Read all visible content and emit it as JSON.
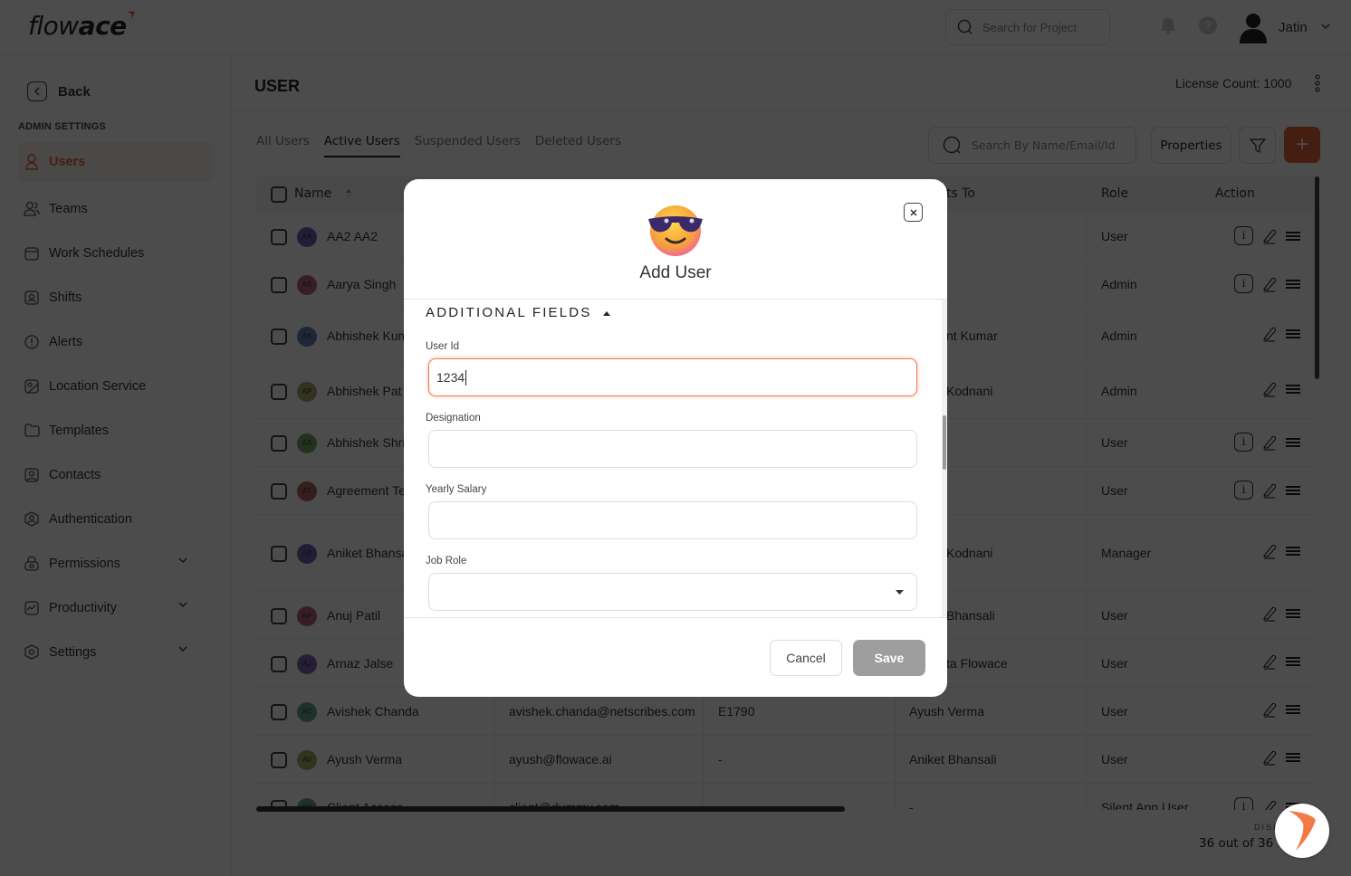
{
  "app": {
    "logo_text_light": "flow",
    "logo_text_bold": "ace",
    "brand_color": "#e8643c"
  },
  "topbar": {
    "project_search_placeholder": "Search for Project",
    "user_name": "Jatin",
    "help_glyph": "?"
  },
  "sidebar": {
    "back_label": "Back",
    "section_label": "ADMIN SETTINGS",
    "items": [
      {
        "label": "Users",
        "icon": "user-icon",
        "active": true
      },
      {
        "label": "Teams",
        "icon": "users-icon"
      },
      {
        "label": "Work Schedules",
        "icon": "calendar-icon"
      },
      {
        "label": "Shifts",
        "icon": "badge-icon"
      },
      {
        "label": "Alerts",
        "icon": "alert-icon"
      },
      {
        "label": "Location Service",
        "icon": "location-icon"
      },
      {
        "label": "Templates",
        "icon": "folder-icon"
      },
      {
        "label": "Contacts",
        "icon": "contact-icon"
      },
      {
        "label": "Authentication",
        "icon": "shield-user-icon"
      },
      {
        "label": "Permissions",
        "icon": "lock-icon",
        "expandable": true
      },
      {
        "label": "Productivity",
        "icon": "chart-icon",
        "expandable": true
      },
      {
        "label": "Settings",
        "icon": "gear-icon",
        "expandable": true
      }
    ]
  },
  "main": {
    "title": "USER",
    "license_count": "License Count: 1000",
    "tabs": [
      {
        "label": "All Users"
      },
      {
        "label": "Active Users",
        "active": true
      },
      {
        "label": "Suspended Users"
      },
      {
        "label": "Deleted Users"
      }
    ],
    "search_placeholder": "Search By Name/Email/Id",
    "properties_label": "Properties",
    "add_label": "+",
    "table": {
      "headers": {
        "name": "Name",
        "reports_to": "ts To",
        "role": "Role",
        "action": "Action"
      },
      "rows": [
        {
          "initials": "AA",
          "name": "AA2 AA2",
          "email": "",
          "emp_id": "",
          "reports_to": "",
          "role": "User",
          "info": true,
          "avatar_color": "#6b64b8"
        },
        {
          "initials": "AS",
          "name": "Aarya Singh",
          "email": "",
          "emp_id": "",
          "reports_to": "",
          "role": "Admin",
          "info": true,
          "avatar_color": "#b8647a"
        },
        {
          "initials": "AK",
          "name": "Abhishek Kum",
          "email": "",
          "emp_id": "",
          "reports_to": "nt Kumar",
          "role": "Admin",
          "info": false,
          "avatar_color": "#6480b8"
        },
        {
          "initials": "AP",
          "name": "Abhishek Pat",
          "email": "",
          "emp_id": "",
          "reports_to": "Kodnani",
          "role": "Admin",
          "info": false,
          "avatar_color": "#a8a864"
        },
        {
          "initials": "AS",
          "name": "Abhishek Shri",
          "email": "",
          "emp_id": "",
          "reports_to": "",
          "role": "User",
          "info": true,
          "avatar_color": "#74a864"
        },
        {
          "initials": "AT",
          "name": "Agreement Te",
          "email": "",
          "emp_id": "",
          "reports_to": "",
          "role": "User",
          "info": true,
          "avatar_color": "#b86464"
        },
        {
          "initials": "AB",
          "name": "Aniket Bhansa",
          "email": "",
          "emp_id": "",
          "reports_to": "Kodnani",
          "role": "Manager",
          "info": false,
          "avatar_color": "#6b64b8"
        },
        {
          "initials": "AP",
          "name": "Anuj Patil",
          "email": "",
          "emp_id": "",
          "reports_to": "Bhansali",
          "role": "User",
          "info": false,
          "avatar_color": "#b8647a"
        },
        {
          "initials": "AJ",
          "name": "Arnaz Jalse",
          "email": "",
          "emp_id": "",
          "reports_to": "ta Flowace",
          "role": "User",
          "info": false,
          "avatar_color": "#8064b8"
        },
        {
          "initials": "AC",
          "name": "Avishek Chanda",
          "email": "avishek.chanda@netscribes.com",
          "emp_id": "E1790",
          "reports_to": "Ayush Verma",
          "role": "User",
          "info": false,
          "avatar_color": "#64a88c"
        },
        {
          "initials": "AV",
          "name": "Ayush Verma",
          "email": "ayush@flowace.ai",
          "emp_id": "-",
          "reports_to": "Aniket Bhansali",
          "role": "User",
          "info": false,
          "avatar_color": "#a8b064"
        },
        {
          "initials": "CA",
          "name": "Client Access",
          "email": "client@dummy.com",
          "emp_id": "-",
          "reports_to": "-",
          "role": "Silent App User",
          "info": true,
          "avatar_color": "#64a880"
        }
      ]
    },
    "display_label": "DISI",
    "display_count": "36 out of 36"
  },
  "modal": {
    "title": "Add User",
    "section_title": "ADDITIONAL FIELDS",
    "fields": {
      "user_id": {
        "label": "User Id",
        "value": "1234"
      },
      "designation": {
        "label": "Designation",
        "value": ""
      },
      "yearly_salary": {
        "label": "Yearly Salary",
        "value": ""
      },
      "job_role": {
        "label": "Job Role",
        "value": ""
      }
    },
    "cancel_label": "Cancel",
    "save_label": "Save",
    "focus_color": "#f07a4a"
  }
}
